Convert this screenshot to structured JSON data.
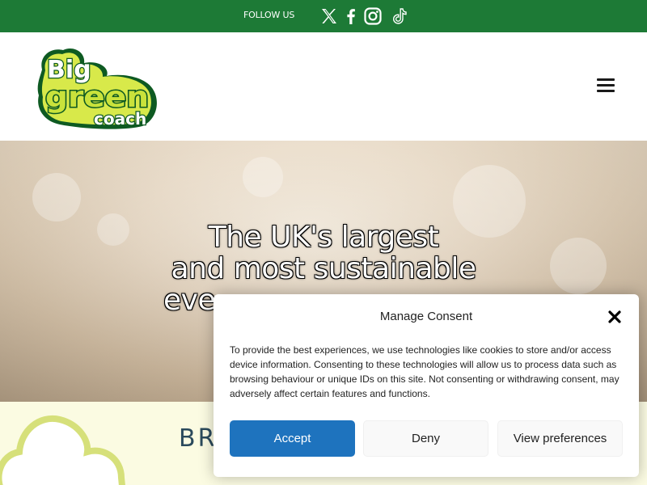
{
  "topbar": {
    "follow_label": "FOLLOW US",
    "social": [
      {
        "icon": "x-twitter-icon"
      },
      {
        "icon": "facebook-icon"
      },
      {
        "icon": "instagram-icon"
      },
      {
        "icon": "tiktok-icon"
      }
    ],
    "background_color": "#1d7a36"
  },
  "header": {
    "logo": {
      "line1": "Big",
      "line2": "green",
      "line3": "coach"
    },
    "menu_icon": "hamburger-menu-icon"
  },
  "hero": {
    "title_line1": "The UK's largest",
    "title_line2": "and most sustainable",
    "title_line3": "eve"
  },
  "section": {
    "heading": "BR",
    "background_color": "#fbfbe2"
  },
  "consent": {
    "title": "Manage Consent",
    "body": "To provide the best experiences, we use technologies like cookies to store and/or access device information. Consenting to these technologies will allow us to process data such as browsing behaviour or unique IDs on this site. Not consenting or withdrawing consent, may adversely affect certain features and functions.",
    "accept_label": "Accept",
    "deny_label": "Deny",
    "preferences_label": "View preferences",
    "accent_color": "#1e73be"
  }
}
